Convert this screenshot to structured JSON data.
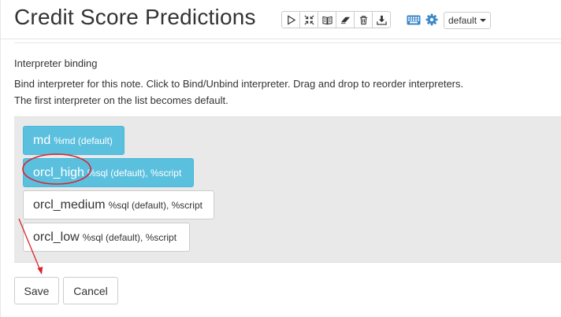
{
  "header": {
    "title": "Credit Score Predictions",
    "toolbar_icons": [
      "play-icon",
      "collapse-icon",
      "book-icon",
      "eraser-icon",
      "trash-icon",
      "download-icon"
    ],
    "dropdown_value": "default"
  },
  "binding": {
    "title": "Interpreter binding",
    "description_line1": "Bind interpreter for this note. Click to Bind/Unbind interpreter. Drag and drop to reorder interpreters.",
    "description_line2": "The first interpreter on the list becomes default.",
    "interpreters": [
      {
        "name": "md",
        "meta": "%md (default)",
        "bound": true
      },
      {
        "name": "orcl_high",
        "meta": "%sql (default), %script",
        "bound": true
      },
      {
        "name": "orcl_medium",
        "meta": "%sql (default), %script",
        "bound": false
      },
      {
        "name": "orcl_low",
        "meta": "%sql (default), %script",
        "bound": false
      }
    ]
  },
  "actions": {
    "save_label": "Save",
    "cancel_label": "Cancel"
  },
  "colors": {
    "bound_bg": "#5bc0de",
    "annotation_red": "#d9232d"
  }
}
